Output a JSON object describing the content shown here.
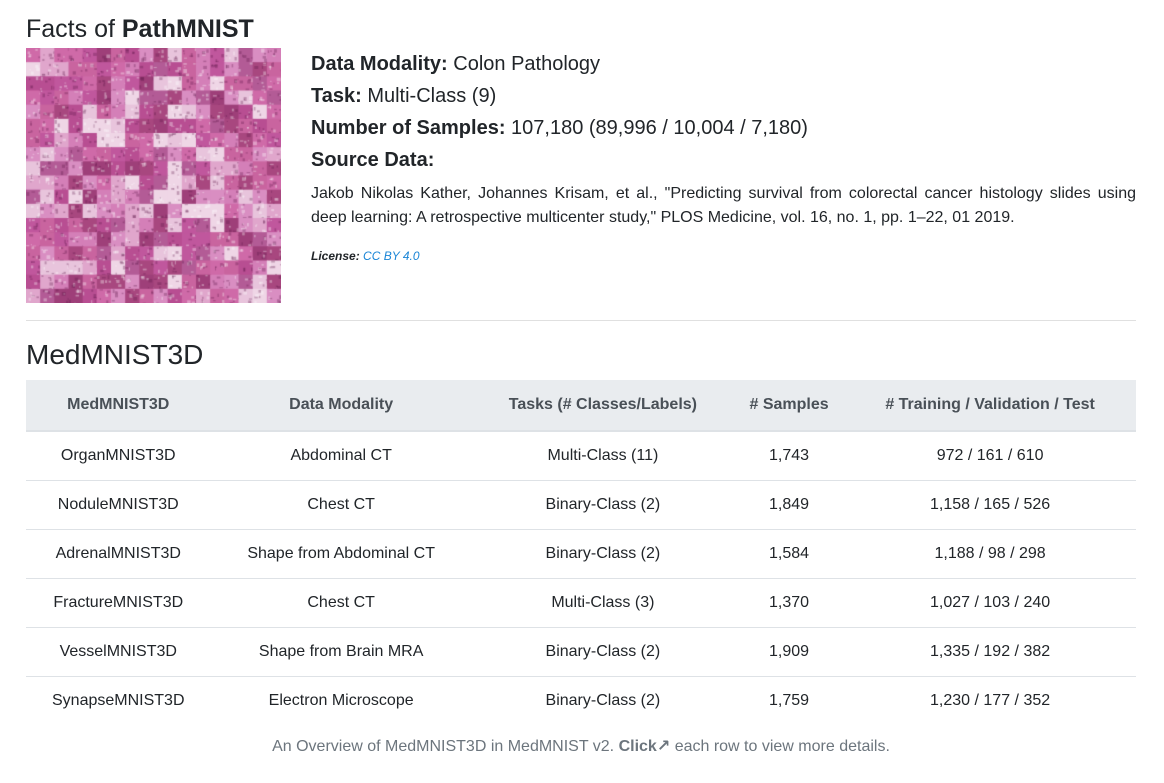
{
  "facts": {
    "title_prefix": "Facts of",
    "dataset_name": "PathMNIST",
    "modality_label": "Data Modality:",
    "modality_value": "Colon Pathology",
    "task_label": "Task:",
    "task_value": "Multi-Class (9)",
    "samples_label": "Number of Samples:",
    "samples_value": "107,180 (89,996 / 10,004 / 7,180)",
    "source_label": "Source Data:",
    "source_text": "Jakob Nikolas Kather, Johannes Krisam, et al., \"Predicting survival from colorectal cancer histology slides using deep learning: A retrospective multicenter study,\" PLOS Medicine, vol. 16, no. 1, pp. 1–22, 01 2019.",
    "license_label": "License:",
    "license_link": "CC BY 4.0",
    "link_color": "#1a85d6"
  },
  "section": {
    "title": "MedMNIST3D"
  },
  "table": {
    "headers": [
      "MedMNIST3D",
      "Data Modality",
      "Tasks (# Classes/Labels)",
      "# Samples",
      "# Training / Validation / Test"
    ],
    "rows": [
      [
        "OrganMNIST3D",
        "Abdominal CT",
        "Multi-Class (11)",
        "1,743",
        "972 / 161 / 610"
      ],
      [
        "NoduleMNIST3D",
        "Chest CT",
        "Binary-Class (2)",
        "1,849",
        "1,158 / 165 / 526"
      ],
      [
        "AdrenalMNIST3D",
        "Shape from Abdominal CT",
        "Binary-Class (2)",
        "1,584",
        "1,188 / 98 / 298"
      ],
      [
        "FractureMNIST3D",
        "Chest CT",
        "Multi-Class (3)",
        "1,370",
        "1,027 / 103 / 240"
      ],
      [
        "VesselMNIST3D",
        "Shape from Brain MRA",
        "Binary-Class (2)",
        "1,909",
        "1,335 / 192 / 382"
      ],
      [
        "SynapseMNIST3D",
        "Electron Microscope",
        "Binary-Class (2)",
        "1,759",
        "1,230 / 177 / 352"
      ]
    ]
  },
  "caption": {
    "prefix": "An Overview of MedMNIST3D in MedMNIST v2.",
    "click": "Click↗",
    "suffix": "each row to view more details."
  }
}
